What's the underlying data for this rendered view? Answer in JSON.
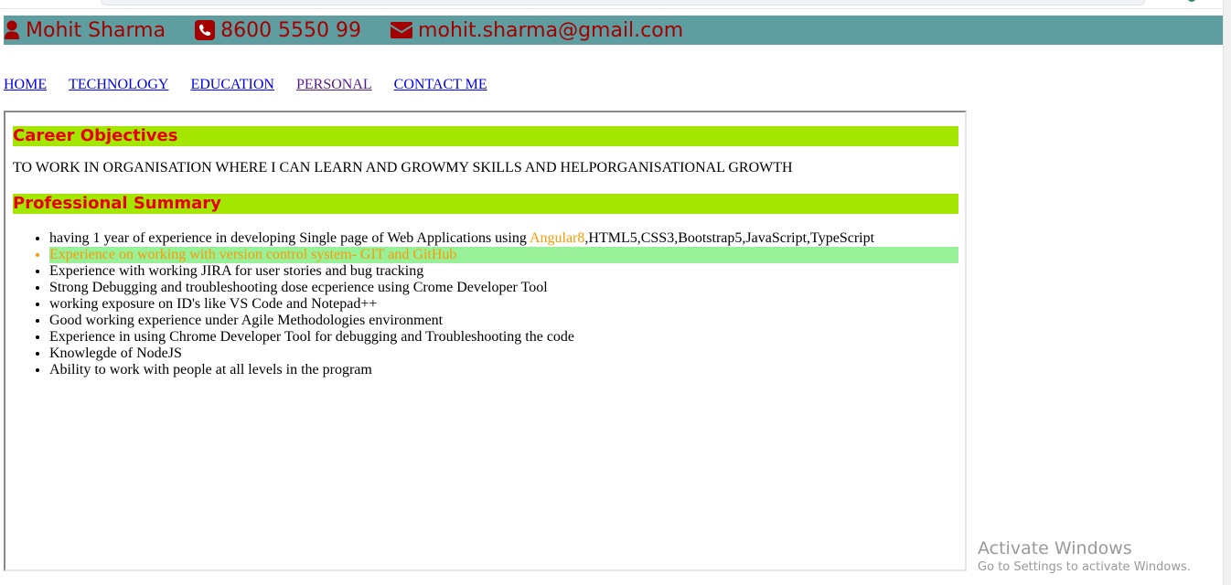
{
  "header": {
    "name": "Mohit Sharma",
    "phone": "8600 5550 99",
    "email": "mohit.sharma@gmail.com",
    "background_color": "#5f9ea0",
    "text_color": "#a40000",
    "icons": [
      "user-icon",
      "phone-icon",
      "envelope-icon"
    ]
  },
  "nav": {
    "items": [
      "HOME",
      "TECHNOLOGY",
      "EDUCATION",
      "PERSONAL",
      "CONTACT ME"
    ]
  },
  "career": {
    "heading": "Career Objectives",
    "text": "TO WORK IN ORGANISATION WHERE I CAN LEARN AND GROWMY SKILLS AND HELPORGANISATIONAL GROWTH"
  },
  "summary": {
    "heading": "Professional Summary",
    "item0_prefix": "having 1 year of experience in developing Single page of Web Applications using ",
    "item0_accent": "Angular8",
    "item0_suffix": ",HTML5,CSS3,Bootstrap5,JavaScript,TypeScript",
    "items": [
      "Experience on working with version control system- GIT and GitHub",
      "Experience with working JIRA for user stories and bug tracking",
      "Strong Debugging and troubleshooting dose ecperience using Crome Developer Tool",
      "working exposure on ID's like VS Code and Notepad++",
      "Good working experience under Agile Methodologies environment",
      "Experience in using Chrome Developer Tool for debugging and Troubleshooting the code",
      "Knowlegde of NodeJS",
      "Ability to work with people at all levels in the program"
    ]
  },
  "colors": {
    "heading_bg": "#a3e600",
    "heading_text": "#e60000",
    "highlight_bg": "#98f098",
    "accent": "#ff9900",
    "link": "#0000ee",
    "visited_link": "#551a8b"
  },
  "watermark": {
    "title": "Activate Windows",
    "subtitle": "Go to Settings to activate Windows."
  }
}
